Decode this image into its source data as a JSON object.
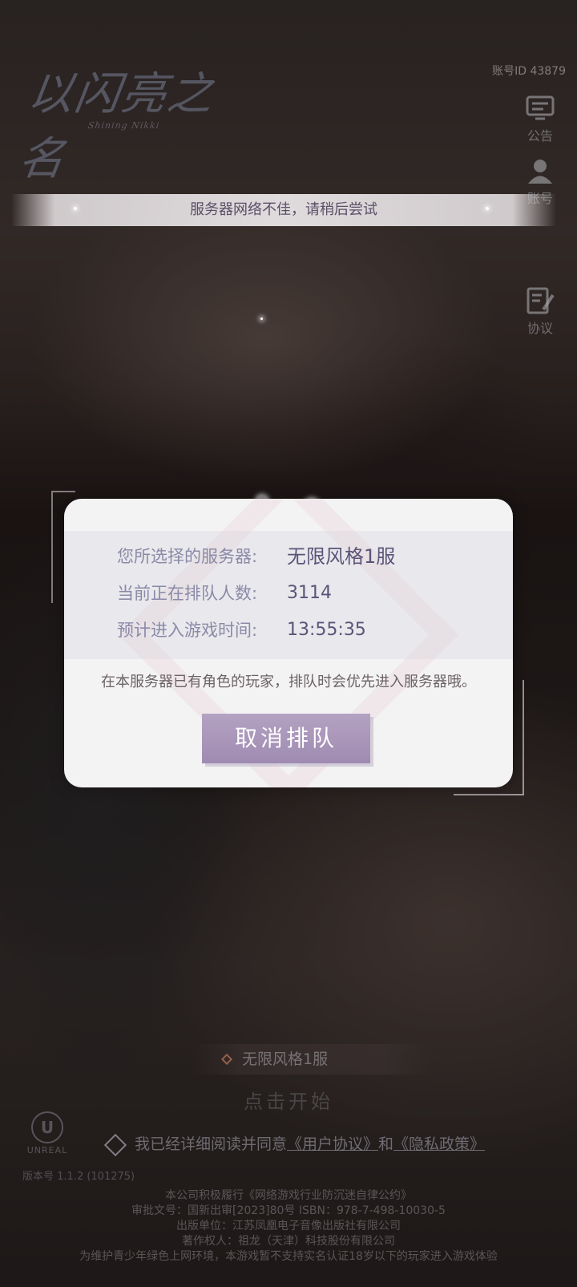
{
  "header": {
    "logo_text": "以闪亮之名",
    "logo_subtext": "Shining Nikki",
    "account_id": "账号ID 43879"
  },
  "side_menu": [
    {
      "label": "公告",
      "icon": "announcement-icon"
    },
    {
      "label": "账号",
      "icon": "user-icon"
    },
    {
      "label": "协议",
      "icon": "agreement-icon"
    }
  ],
  "toast": {
    "message": "服务器网络不佳，请稍后尝试"
  },
  "queue_dialog": {
    "server_label": "您所选择的服务器:",
    "server_value": "无限风格1服",
    "queue_label": "当前正在排队人数:",
    "queue_value": "3114",
    "eta_label": "预计进入游戏时间:",
    "eta_value": "13:55:35",
    "note": "在本服务器已有角色的玩家，排队时会优先进入服务器哦。",
    "cancel_label": "取消排队"
  },
  "bottom": {
    "server_name": "无限风格1服",
    "start_label": "点击开始",
    "agree_prefix": "我已经详细阅读并同意",
    "user_agreement": "《用户协议》",
    "agree_and": "和",
    "privacy_policy": "《隐私政策》",
    "engine_logo": "UNREAL",
    "version": "版本号 1.1.2 (101275)"
  },
  "footer_lines": [
    "本公司积极履行《网络游戏行业防沉迷自律公约》",
    "审批文号：国新出审[2023]80号  ISBN：978-7-498-10030-5",
    "出版单位：江苏凤凰电子音像出版社有限公司",
    "著作权人：祖龙（天津）科技股份有限公司",
    "为维护青少年绿色上网环境，本游戏暂不支持实名认证18岁以下的玩家进入游戏体验"
  ]
}
